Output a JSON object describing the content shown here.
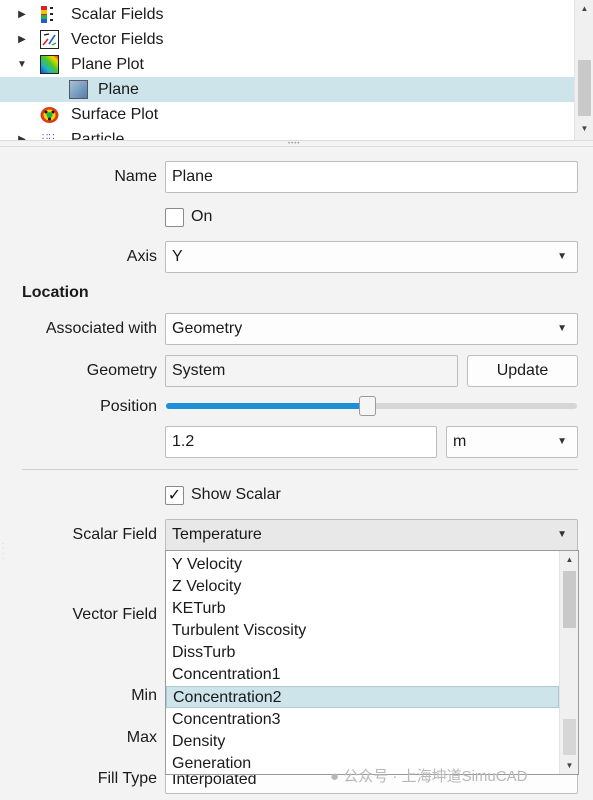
{
  "tree": {
    "items": [
      {
        "label": "Scalar Fields",
        "icon": "scalar-fields-icon",
        "expanded": false
      },
      {
        "label": "Vector Fields",
        "icon": "vector-fields-icon",
        "expanded": false
      },
      {
        "label": "Plane Plot",
        "icon": "plane-plot-icon",
        "expanded": true
      },
      {
        "label": "Plane",
        "icon": "plane-icon",
        "selected": true
      },
      {
        "label": "Surface Plot",
        "icon": "surface-plot-icon"
      },
      {
        "label": "Particle...",
        "icon": "particle-icon",
        "expanded": false
      }
    ]
  },
  "properties": {
    "name_label": "Name",
    "name_value": "Plane",
    "on_label": "On",
    "on_checked": false,
    "axis_label": "Axis",
    "axis_value": "Y",
    "location_heading": "Location",
    "associated_label": "Associated with",
    "associated_value": "Geometry",
    "geometry_label": "Geometry",
    "geometry_value": "System",
    "update_label": "Update",
    "position_label": "Position",
    "position_slider_fraction": 0.49,
    "position_value": "1.2",
    "position_unit": "m",
    "show_scalar_label": "Show Scalar",
    "show_scalar_checked": true,
    "scalar_field_label": "Scalar Field",
    "scalar_field_value": "Temperature",
    "vector_field_label": "Vector Field",
    "min_label": "Min",
    "max_label": "Max",
    "fill_type_label": "Fill Type",
    "fill_type_value": "Interpolated"
  },
  "dropdown": {
    "items": [
      "Y Velocity",
      "Z Velocity",
      "KETurb",
      "Turbulent Viscosity",
      "DissTurb",
      "Concentration1",
      "Concentration2",
      "Concentration3",
      "Density",
      "Generation"
    ],
    "highlighted_index": 6
  },
  "watermark": "公众号 · 上海坤道SimuCAD",
  "colors": {
    "selection": "#cde4ea",
    "slider_accent": "#1e90d8",
    "panel_bg": "#f3f3f3"
  }
}
